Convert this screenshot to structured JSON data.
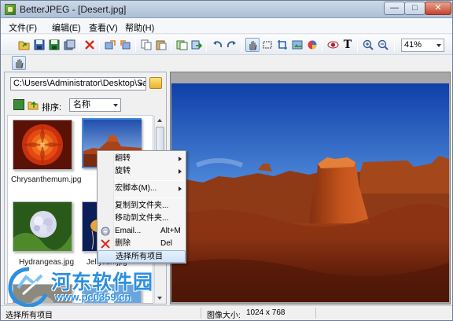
{
  "window": {
    "title": "BetterJPEG - [Desert.jpg]"
  },
  "menubar": {
    "items": [
      "文件(F)",
      "编辑(E)",
      "查看(V)",
      "帮助(H)"
    ]
  },
  "toolbar": {
    "icons": [
      "open-icon",
      "save-icon",
      "save-as-icon",
      "batch-icon",
      "delete-icon",
      "rotate-left-file-icon",
      "rotate-right-file-icon",
      "copy-icon",
      "paste-icon",
      "copy-to-icon",
      "move-to-icon",
      "undo-icon",
      "redo-icon",
      "hand-tool-icon",
      "select-tool-icon",
      "crop-icon",
      "redeye-icon",
      "color-icon",
      "eye-icon",
      "text-icon",
      "zoom-in-icon",
      "zoom-out-icon"
    ],
    "zoom": "41%"
  },
  "left_pane": {
    "path": "C:\\Users\\Administrator\\Desktop\\Sam",
    "sort_label": "排序:",
    "sort_value": "名称",
    "thumbnails": [
      {
        "caption": "Chrysanthemum.jpg"
      },
      {
        "caption": ""
      },
      {
        "caption": "Hydrangeas.jpg"
      },
      {
        "caption": "Jellyfish.jpg"
      }
    ]
  },
  "context_menu": {
    "items": [
      {
        "label": "翻转",
        "shortcut": "",
        "submenu": true
      },
      {
        "label": "旋转",
        "shortcut": "",
        "submenu": true
      },
      {
        "label": "宏脚本(M)...",
        "shortcut": "",
        "submenu": true
      },
      {
        "label": "复制到文件夹...",
        "shortcut": "",
        "submenu": false
      },
      {
        "label": "移动到文件夹...",
        "shortcut": "",
        "submenu": false
      },
      {
        "label": "Email...",
        "shortcut": "Alt+M",
        "submenu": false,
        "icon": "email-icon"
      },
      {
        "label": "删除",
        "shortcut": "Del",
        "submenu": false,
        "icon": "delete-x-icon"
      },
      {
        "label": "选择所有项目",
        "shortcut": "",
        "submenu": false
      }
    ]
  },
  "statusbar": {
    "left": "选择所有项目",
    "image_size_label": "图像大小:",
    "image_size_value": "1024 x 768"
  },
  "watermark": {
    "text": "河东软件园",
    "url": "www.pc0359.cn"
  },
  "colors": {
    "selection": "#4d8fd9",
    "watermark": "#2d8fe0",
    "delete": "#d62b1e"
  }
}
